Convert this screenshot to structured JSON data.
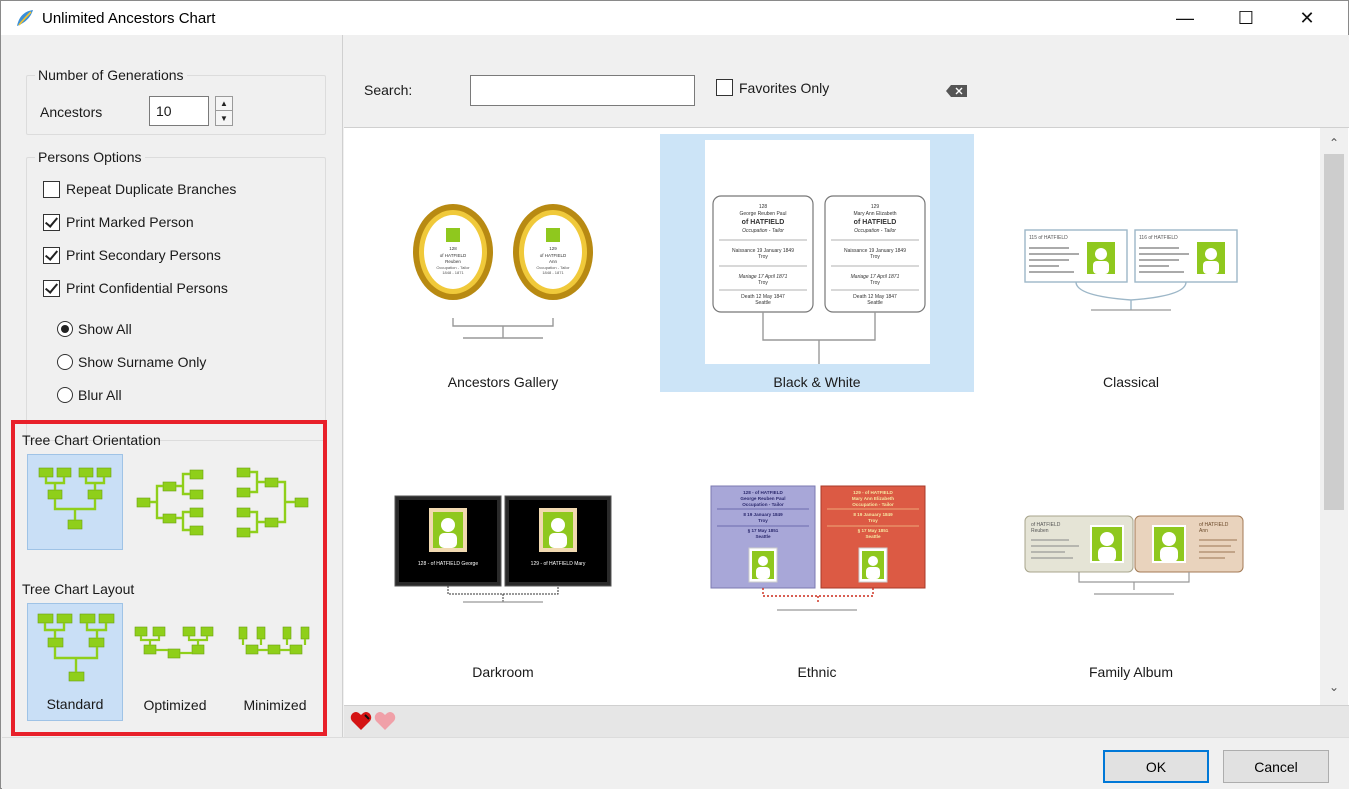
{
  "window": {
    "title": "Unlimited Ancestors Chart",
    "minimize_glyph": "—",
    "maximize_glyph": "☐",
    "close_glyph": "✕"
  },
  "generations": {
    "legend": "Number of Generations",
    "ancestors_label": "Ancestors",
    "ancestors_value": "10"
  },
  "persons_options": {
    "legend": "Persons Options",
    "checkboxes": [
      {
        "label": "Repeat Duplicate Branches",
        "checked": false
      },
      {
        "label": "Print Marked Person",
        "checked": true
      },
      {
        "label": "Print Secondary Persons",
        "checked": true
      },
      {
        "label": "Print Confidential Persons",
        "checked": true
      }
    ],
    "radios": [
      {
        "label": "Show All",
        "selected": true
      },
      {
        "label": "Show Surname Only",
        "selected": false
      },
      {
        "label": "Blur All",
        "selected": false
      }
    ]
  },
  "orientation": {
    "title": "Tree Chart Orientation",
    "options": [
      "top-down-tree-icon",
      "horizontal-both-sides-icon",
      "left-to-right-tree-icon"
    ],
    "selected_index": 0
  },
  "layout": {
    "title": "Tree Chart Layout",
    "options": [
      "Standard",
      "Optimized",
      "Minimized"
    ],
    "selected_index": 0
  },
  "search": {
    "label": "Search:",
    "value": "",
    "favorites_label": "Favorites Only",
    "favorites_checked": false
  },
  "styles": [
    {
      "name": "Ancestors Gallery",
      "selected": false
    },
    {
      "name": "Black & White",
      "selected": true
    },
    {
      "name": "Classical",
      "selected": false
    },
    {
      "name": "Darkroom",
      "selected": false
    },
    {
      "name": "Ethnic",
      "selected": false
    },
    {
      "name": "Family Album",
      "selected": false
    }
  ],
  "thumb_texts": {
    "bw_left": [
      "128",
      "George Reuben Paul",
      "of HATFIELD",
      "Occupation - Tailor",
      "Naissance 19 January 1849",
      "Troy",
      "Mariage 17 April 1871",
      "Troy",
      "Death 12 May 1847",
      "Seattle"
    ],
    "bw_right": [
      "129",
      "Mary Ann Elizabeth",
      "of HATFIELD",
      "Occupation - Tailor",
      "Naissance 19 January 1849",
      "Troy",
      "Mariage 17 April 1871",
      "Troy",
      "Death 12 May 1847",
      "Seattle"
    ],
    "gallery_left": [
      "128",
      "of HATFIELD",
      "Reuben",
      "Occupation - Tailor",
      "1848 - 1871"
    ],
    "gallery_right": [
      "129",
      "of HATFIELD",
      "Ann",
      "Occupation - Tailor",
      "1848 - 1871"
    ],
    "classical": [
      "115 of HATFIELD",
      "116 of HATFIELD"
    ],
    "darkroom": [
      "128 - of HATFIELD George",
      "129 - of HATFIELD Mary"
    ],
    "ethnic_left": [
      "128 - of HATFIELD",
      "George Reuben Paul",
      "Occupation - Tailor",
      "8 19 January 1849",
      "Troy",
      "§ 17 May 1851",
      "Seattle"
    ],
    "ethnic_right": [
      "129 - of HATFIELD",
      "Mary Ann Elizabeth",
      "Occupation - Tailor",
      "8 19 January 1849",
      "Troy",
      "§ 17 May 1851",
      "Seattle"
    ],
    "album": [
      "of HATFIELD",
      "Reuben",
      "of HATFIELD",
      "Ann"
    ]
  },
  "footer": {
    "ok_label": "OK",
    "cancel_label": "Cancel"
  },
  "colors": {
    "selection": "#cce4f7",
    "highlight_border": "#e8202a",
    "tree_green": "#8fcf1a",
    "default_button_border": "#0078d7"
  }
}
